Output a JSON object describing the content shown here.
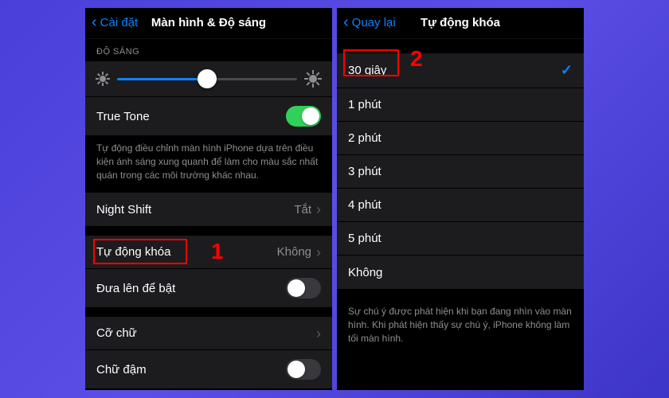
{
  "left": {
    "nav": {
      "back": "Cài đặt",
      "title": "Màn hình & Độ sáng"
    },
    "brightness": {
      "header": "ĐỘ SÁNG",
      "percent": 50
    },
    "trueTone": {
      "label": "True Tone",
      "enabled": true,
      "note": "Tự động điều chỉnh màn hình iPhone dựa trên điều kiện ánh sáng xung quanh để làm cho màu sắc nhất quán trong các môi trường khác nhau."
    },
    "nightShift": {
      "label": "Night Shift",
      "value": "Tắt"
    },
    "autoLock": {
      "label": "Tự động khóa",
      "value": "Không"
    },
    "raiseToWake": {
      "label": "Đưa lên để bật",
      "enabled": false
    },
    "textSize": {
      "label": "Cỡ chữ"
    },
    "boldText": {
      "label": "Chữ đậm",
      "enabled": false
    }
  },
  "right": {
    "nav": {
      "back": "Quay lại",
      "title": "Tự động khóa"
    },
    "options": [
      {
        "label": "30 giây",
        "selected": true
      },
      {
        "label": "1 phút",
        "selected": false
      },
      {
        "label": "2 phút",
        "selected": false
      },
      {
        "label": "3 phút",
        "selected": false
      },
      {
        "label": "4 phút",
        "selected": false
      },
      {
        "label": "5 phút",
        "selected": false
      },
      {
        "label": "Không",
        "selected": false
      }
    ],
    "note": "Sự chú ý được phát hiện khi bạn đang nhìn vào màn hình. Khi phát hiện thấy sự chú ý, iPhone không làm tối màn hình."
  },
  "annotations": {
    "one": "1",
    "two": "2"
  }
}
